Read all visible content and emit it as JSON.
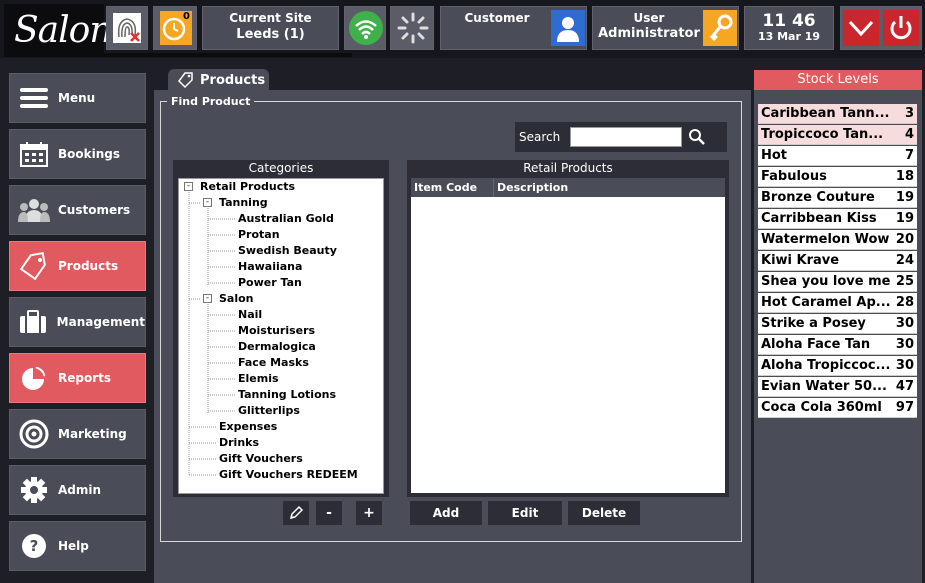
{
  "app": {
    "logo": "Salon"
  },
  "topbar": {
    "notifications_count": "0",
    "site_label": "Current Site",
    "site_value": "Leeds (1)",
    "customer_label": "Customer",
    "user_label": "User",
    "user_value": "Administrator",
    "time": "11 46",
    "date": "13 Mar 19"
  },
  "sidebar": {
    "items": [
      {
        "label": "Menu",
        "icon": "hamburger-icon"
      },
      {
        "label": "Bookings",
        "icon": "calendar-icon"
      },
      {
        "label": "Customers",
        "icon": "people-icon"
      },
      {
        "label": "Products",
        "icon": "tag-icon",
        "active": true
      },
      {
        "label": "Management",
        "icon": "briefcase-icon"
      },
      {
        "label": "Reports",
        "icon": "pie-chart-icon",
        "active": true
      },
      {
        "label": "Marketing",
        "icon": "target-icon"
      },
      {
        "label": "Admin",
        "icon": "gear-icon"
      },
      {
        "label": "Help",
        "icon": "help-icon"
      }
    ]
  },
  "main": {
    "tab_label": "Products",
    "group_title": "Find Product",
    "search_label": "Search",
    "search_value": "",
    "categories_title": "Categories",
    "tree": [
      {
        "label": "Retail Products",
        "level": 0,
        "expander": "-"
      },
      {
        "label": "Tanning",
        "level": 1,
        "expander": "-"
      },
      {
        "label": "Australian Gold",
        "level": 2
      },
      {
        "label": "Protan",
        "level": 2
      },
      {
        "label": "Swedish Beauty",
        "level": 2
      },
      {
        "label": "Hawaiiana",
        "level": 2
      },
      {
        "label": "Power Tan",
        "level": 2
      },
      {
        "label": "Salon",
        "level": 1,
        "expander": "-"
      },
      {
        "label": "Nail",
        "level": 2
      },
      {
        "label": "Moisturisers",
        "level": 2
      },
      {
        "label": "Dermalogica",
        "level": 2
      },
      {
        "label": "Face Masks",
        "level": 2
      },
      {
        "label": "Elemis",
        "level": 2
      },
      {
        "label": "Tanning Lotions",
        "level": 2
      },
      {
        "label": "Glitterlips",
        "level": 2
      },
      {
        "label": "Expenses",
        "level": 1
      },
      {
        "label": "Drinks",
        "level": 1
      },
      {
        "label": "Gift Vouchers",
        "level": 1
      },
      {
        "label": "Gift Vouchers REDEEM",
        "level": 1
      }
    ],
    "products_title": "Retail Products",
    "columns": [
      "Item Code",
      "Description"
    ],
    "minus_label": "-",
    "plus_label": "+",
    "add_label": "Add",
    "edit_label": "Edit",
    "delete_label": "Delete"
  },
  "stock": {
    "title": "Stock Levels",
    "items": [
      {
        "name": "Caribbean Tann...",
        "qty": "3",
        "low": true
      },
      {
        "name": "Tropiccoco Tan...",
        "qty": "4",
        "low": true
      },
      {
        "name": "Hot",
        "qty": "7"
      },
      {
        "name": "Fabulous",
        "qty": "18"
      },
      {
        "name": "Bronze Couture",
        "qty": "19"
      },
      {
        "name": "Carribbean Kiss",
        "qty": "19"
      },
      {
        "name": "Watermelon Wow",
        "qty": "20"
      },
      {
        "name": "Kiwi Krave",
        "qty": "24"
      },
      {
        "name": "Shea you love me",
        "qty": "25"
      },
      {
        "name": "Hot Caramel Ap...",
        "qty": "28"
      },
      {
        "name": "Strike a Posey",
        "qty": "30"
      },
      {
        "name": "Aloha Face Tan",
        "qty": "30"
      },
      {
        "name": "Aloha Tropiccoc...",
        "qty": "30"
      },
      {
        "name": "Evian Water 50...",
        "qty": "47"
      },
      {
        "name": "Coca Cola 360ml",
        "qty": "97"
      }
    ]
  },
  "colors": {
    "accent": "#e05a5f",
    "panel": "#4a4c58",
    "dark": "#2c2d36",
    "alert_icon": "#f5a623",
    "wifi": "#3fb04a"
  }
}
